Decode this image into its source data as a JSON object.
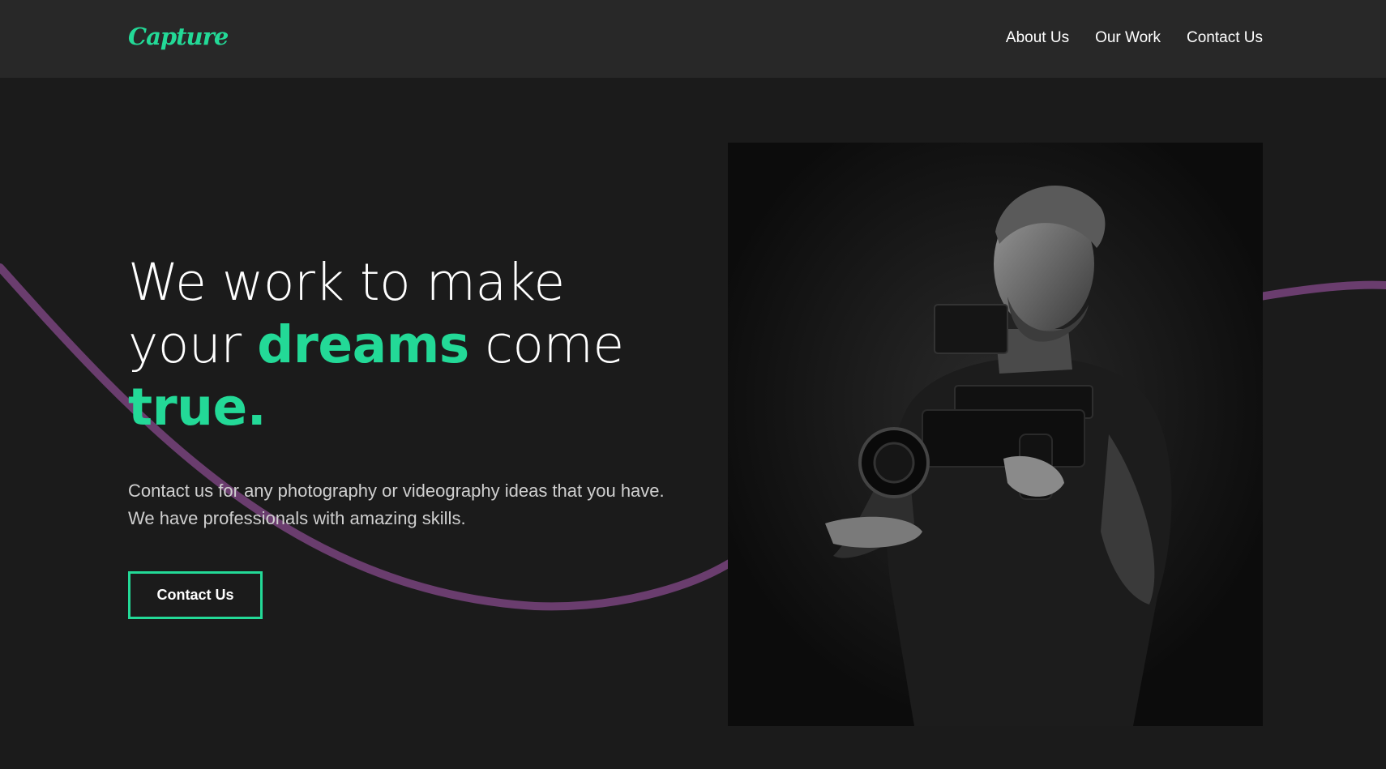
{
  "header": {
    "logo": "Capture",
    "nav": [
      {
        "label": "About Us"
      },
      {
        "label": "Our Work"
      },
      {
        "label": "Contact Us"
      }
    ]
  },
  "hero": {
    "headline_line1": "We work to make",
    "headline_line2_pre": "your ",
    "headline_line2_accent": "dreams",
    "headline_line2_post": " come",
    "headline_line3_accent": "true.",
    "description": "Contact us for any photography or videography ideas that you have. We have professionals with amazing skills.",
    "cta_label": "Contact Us"
  },
  "photo": {
    "subject": "photographer-with-camera-rig"
  },
  "colors": {
    "accent": "#23d997",
    "header_bg": "#282828",
    "page_bg": "#1b1b1b",
    "swoosh": "#6a3d6e"
  }
}
